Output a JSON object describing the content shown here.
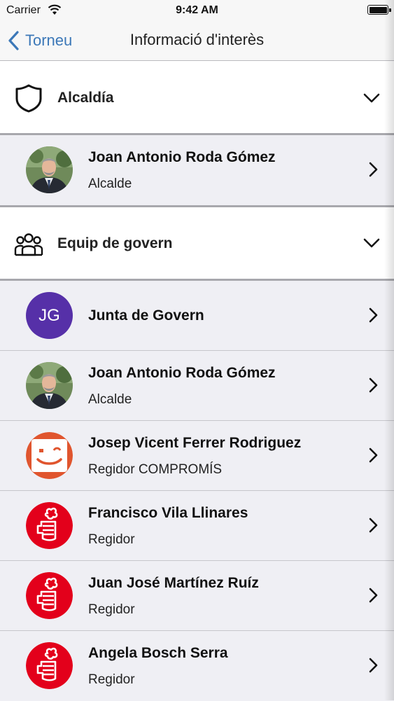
{
  "status_bar": {
    "carrier": "Carrier",
    "time": "9:42 AM"
  },
  "nav": {
    "back_label": "Torneu",
    "title": "Informació d'interès"
  },
  "sections": [
    {
      "title": "Alcaldía",
      "icon": "shield-icon"
    },
    {
      "title": "Equip de govern",
      "icon": "group-icon"
    }
  ],
  "alcaldia_items": [
    {
      "name": "Joan Antonio Roda Gómez",
      "role": "Alcalde",
      "avatar": "photo"
    }
  ],
  "govern_items": [
    {
      "name": "Junta de Govern",
      "initials": "JG",
      "avatar": "initials",
      "color": "#5630a8"
    },
    {
      "name": "Joan Antonio Roda Gómez",
      "role": "Alcalde",
      "avatar": "photo"
    },
    {
      "name": "Josep Vicent Ferrer Rodriguez",
      "role": "Regidor COMPROMÍS",
      "avatar": "compromis-logo",
      "color": "#e0552e"
    },
    {
      "name": "Francisco Vila Llinares",
      "role": "Regidor",
      "avatar": "psoe-logo",
      "color": "#e3001b"
    },
    {
      "name": "Juan José Martínez Ruíz",
      "role": "Regidor",
      "avatar": "psoe-logo",
      "color": "#e3001b"
    },
    {
      "name": "Angela Bosch Serra",
      "role": "Regidor",
      "avatar": "psoe-logo",
      "color": "#e3001b"
    }
  ]
}
